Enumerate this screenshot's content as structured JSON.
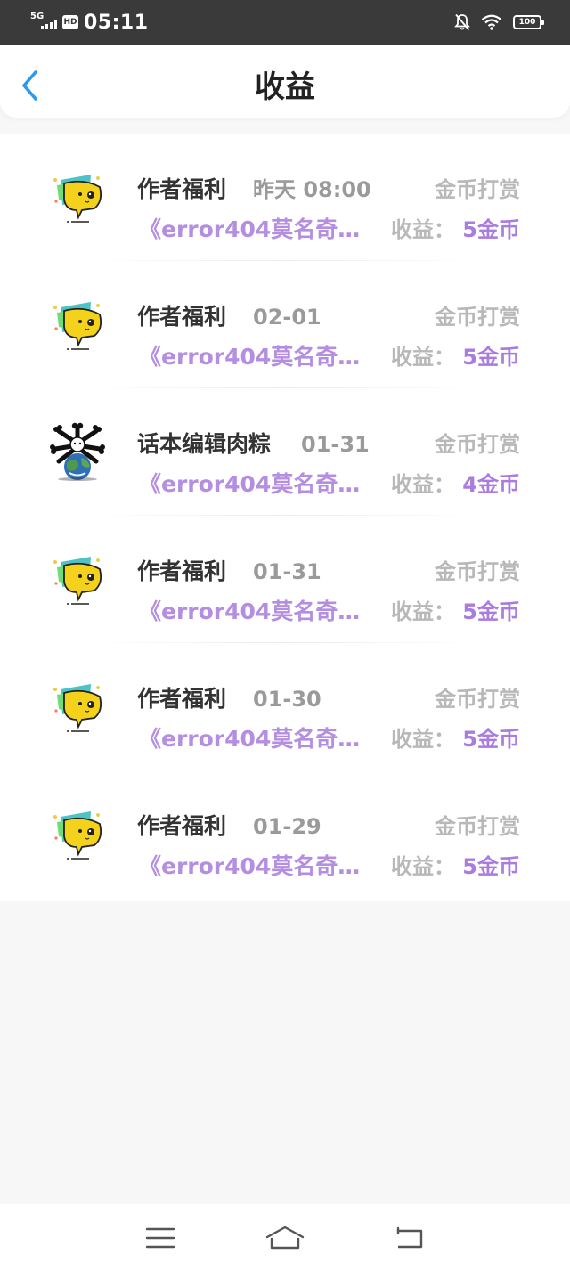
{
  "status_bar": {
    "network": "5G",
    "hd": "HD",
    "time": "05:11",
    "battery": "100"
  },
  "header": {
    "title": "收益"
  },
  "rows": [
    {
      "name": "作者福利",
      "date": "昨天 08:00",
      "type": "金币打赏",
      "book": "《error404莫名奇…",
      "earn_label": "收益：",
      "earn_value": "5金币",
      "avatar": "yellow-chat-mascot"
    },
    {
      "name": "作者福利",
      "date": "02-01",
      "type": "金币打赏",
      "book": "《error404莫名奇…",
      "earn_label": "收益：",
      "earn_value": "5金币",
      "avatar": "yellow-chat-mascot"
    },
    {
      "name": "话本编辑肉粽",
      "date": "01-31",
      "type": "金币打赏",
      "book": "《error404莫名奇…",
      "earn_label": "收益：",
      "earn_value": "4金币",
      "avatar": "bone-earth-avatar"
    },
    {
      "name": "作者福利",
      "date": "01-31",
      "type": "金币打赏",
      "book": "《error404莫名奇…",
      "earn_label": "收益：",
      "earn_value": "5金币",
      "avatar": "yellow-chat-mascot"
    },
    {
      "name": "作者福利",
      "date": "01-30",
      "type": "金币打赏",
      "book": "《error404莫名奇…",
      "earn_label": "收益：",
      "earn_value": "5金币",
      "avatar": "yellow-chat-mascot"
    },
    {
      "name": "作者福利",
      "date": "01-29",
      "type": "金币打赏",
      "book": "《error404莫名奇…",
      "earn_label": "收益：",
      "earn_value": "5金币",
      "avatar": "yellow-chat-mascot"
    }
  ],
  "colors": {
    "accent_blue": "#2a9af0",
    "purple": "#a97cde",
    "grey_text": "#b8b8b8"
  },
  "nav_bar": {
    "icons": [
      "menu-icon",
      "home-icon",
      "back-icon"
    ]
  }
}
